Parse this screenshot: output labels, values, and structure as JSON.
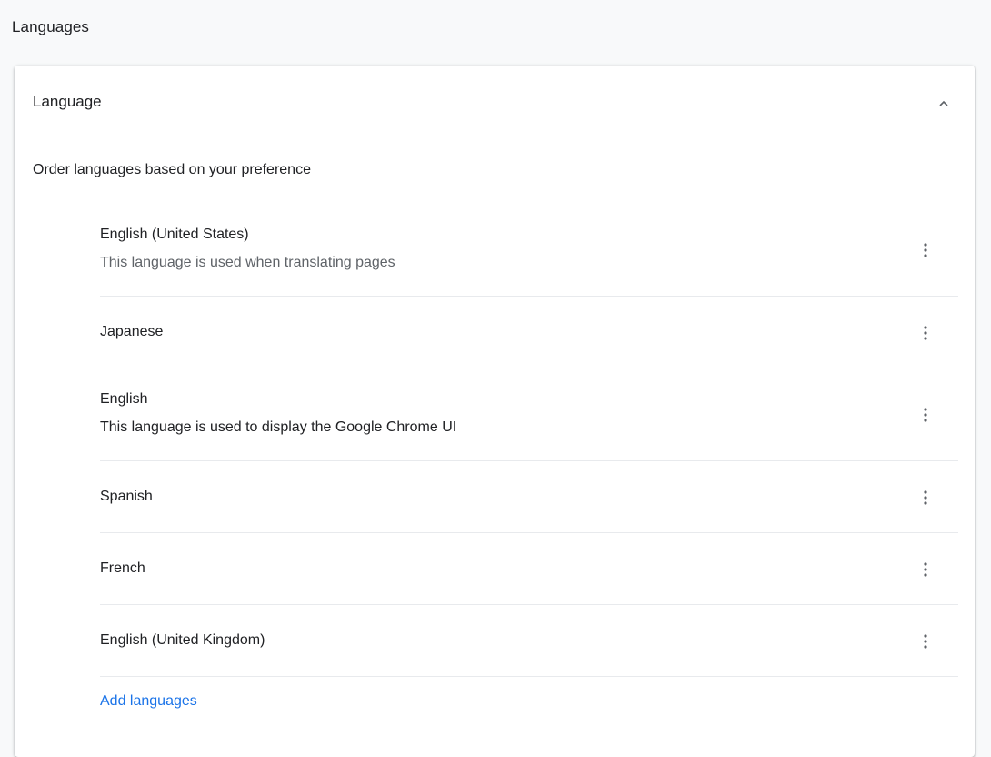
{
  "section": {
    "title": "Languages"
  },
  "card": {
    "header_title": "Language",
    "instruction": "Order languages based on your preference",
    "languages": [
      {
        "name": "English (United States)",
        "sub": "This language is used when translating pages"
      },
      {
        "name": "Japanese",
        "sub": ""
      },
      {
        "name": "English",
        "sub": "This language is used to display the Google Chrome UI"
      },
      {
        "name": "Spanish",
        "sub": ""
      },
      {
        "name": "French",
        "sub": ""
      },
      {
        "name": "English (United Kingdom)",
        "sub": ""
      }
    ],
    "add_languages_label": "Add languages"
  },
  "icons": {
    "collapse": "chevron-up-icon",
    "row_menu": "more-vert-icon"
  },
  "colors": {
    "page_bg": "#f8f9fa",
    "card_bg": "#ffffff",
    "link": "#1a73e8",
    "secondary_text": "#5f6368",
    "icon": "#5f6368",
    "divider": "#e8eaed"
  }
}
